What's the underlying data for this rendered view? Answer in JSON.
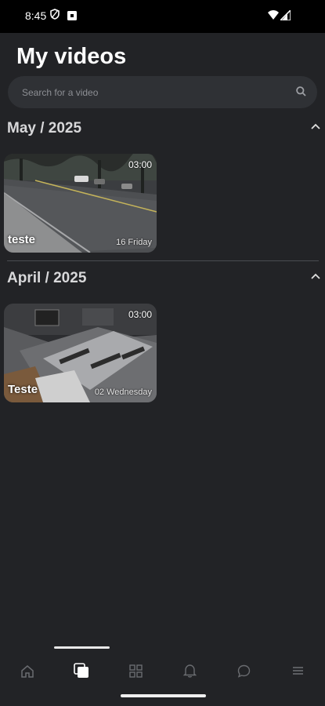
{
  "status": {
    "time": "8:45"
  },
  "header": {
    "title": "My videos"
  },
  "search": {
    "placeholder": "Search for a video"
  },
  "sections": [
    {
      "title": "May / 2025",
      "videos": [
        {
          "title": "teste",
          "duration": "03:00",
          "date": "16 Friday"
        }
      ]
    },
    {
      "title": "April / 2025",
      "videos": [
        {
          "title": "Teste",
          "duration": "03:00",
          "date": "02 Wednesday"
        }
      ]
    }
  ],
  "bottom_nav": {
    "items": [
      {
        "icon": "home-icon",
        "active": false
      },
      {
        "icon": "videos-icon",
        "active": true
      },
      {
        "icon": "grid-icon",
        "active": false
      },
      {
        "icon": "bell-icon",
        "active": false
      },
      {
        "icon": "chat-icon",
        "active": false
      },
      {
        "icon": "menu-icon",
        "active": false
      }
    ]
  },
  "colors": {
    "background": "#222326",
    "search_bg": "#2f3135",
    "text_muted": "#8d8f94"
  }
}
